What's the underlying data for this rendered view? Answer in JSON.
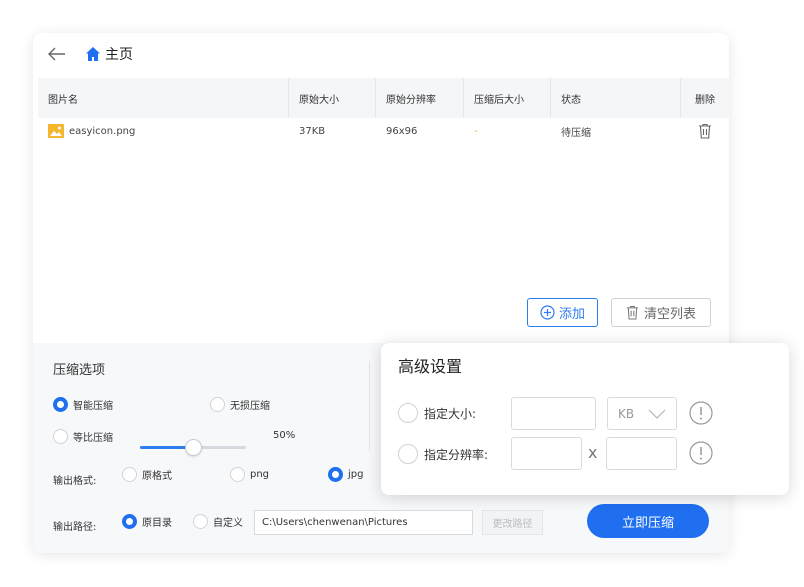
{
  "nav": {
    "home_label": "主页"
  },
  "table": {
    "headers": [
      "图片名",
      "原始大小",
      "原始分辨率",
      "压缩后大小",
      "状态",
      "删除"
    ],
    "rows": [
      {
        "name": "easyicon.png",
        "size": "37KB",
        "resolution": "96x96",
        "compressed": "-",
        "status": "待压缩"
      }
    ]
  },
  "actions": {
    "add_label": "添加",
    "clear_label": "清空列表"
  },
  "options": {
    "title": "压缩选项",
    "mode_smart": "智能压缩",
    "mode_lossless": "无损压缩",
    "mode_ratio": "等比压缩",
    "ratio_value": "50%",
    "ratio_fraction": 0.5,
    "format_label": "输出格式:",
    "format_original": "原格式",
    "format_png": "png",
    "format_jpg": "jpg",
    "path_label": "输出路径:",
    "path_original": "原目录",
    "path_custom": "自定义",
    "path_value": "C:\\Users\\chenwenan\\Pictures",
    "change_path": "更改路径",
    "compress_button": "立即压缩"
  },
  "advanced": {
    "title": "高级设置",
    "size_label": "指定大小:",
    "unit": "KB",
    "resolution_label": "指定分辨率:",
    "x_sep": "x"
  },
  "colors": {
    "accent": "#1f6ff0"
  }
}
